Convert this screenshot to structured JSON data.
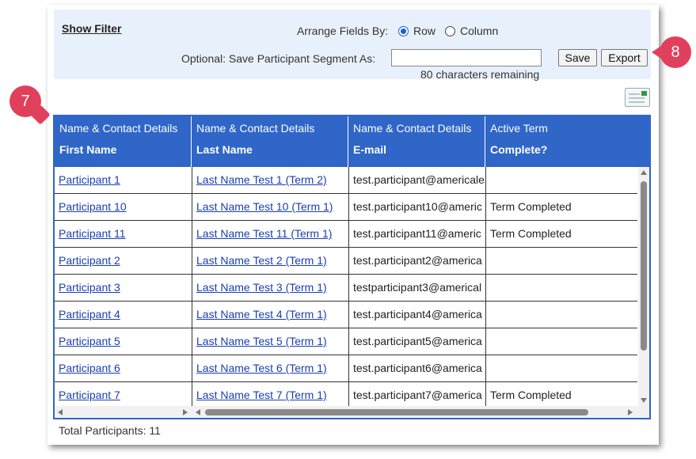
{
  "filter": {
    "show_filter": "Show Filter",
    "arrange_label": "Arrange Fields By:",
    "row_label": "Row",
    "column_label": "Column",
    "arrange_selected": "Row",
    "save_segment_label": "Optional: Save Participant Segment As:",
    "segment_value": "",
    "remaining": "80 characters remaining",
    "save_button": "Save",
    "export_button": "Export"
  },
  "callouts": {
    "c7": "7",
    "c8": "8"
  },
  "icons": {
    "export": "export-spreadsheet-icon",
    "accent": "#2f66c8",
    "callout_color": "#e0405c"
  },
  "table": {
    "columns": [
      {
        "group": "Name & Contact Details",
        "name": "First Name"
      },
      {
        "group": "Name & Contact Details",
        "name": "Last Name"
      },
      {
        "group": "Name & Contact Details",
        "name": "E-mail"
      },
      {
        "group": "Active Term",
        "name": "Complete?"
      }
    ],
    "rows": [
      {
        "first": "Participant 1",
        "last": "Last Name Test 1 (Term 2)",
        "email": "test.participant@americale",
        "complete": ""
      },
      {
        "first": "Participant 10",
        "last": "Last Name Test 10 (Term 1)",
        "email": "test.participant10@americ",
        "complete": "Term Completed"
      },
      {
        "first": "Participant 11",
        "last": "Last Name Test 11 (Term 1)",
        "email": "test.participant11@americ",
        "complete": "Term Completed"
      },
      {
        "first": "Participant 2",
        "last": "Last Name Test 2 (Term 1)",
        "email": "test.participant2@america",
        "complete": ""
      },
      {
        "first": "Participant 3",
        "last": "Last Name Test 3 (Term 1)",
        "email": "testparticipant3@americal",
        "complete": ""
      },
      {
        "first": "Participant 4",
        "last": "Last Name Test 4 (Term 1)",
        "email": "test.participant4@america",
        "complete": ""
      },
      {
        "first": "Participant 5",
        "last": "Last Name Test 5 (Term 1)",
        "email": "test.participant5@america",
        "complete": ""
      },
      {
        "first": "Participant 6",
        "last": "Last Name Test 6 (Term 1)",
        "email": "test.participant6@america",
        "complete": ""
      },
      {
        "first": "Participant 7",
        "last": "Last Name Test 7 (Term 1)",
        "email": "test.participant7@america",
        "complete": "Term Completed"
      }
    ]
  },
  "footer": {
    "total": "Total Participants: 11"
  }
}
